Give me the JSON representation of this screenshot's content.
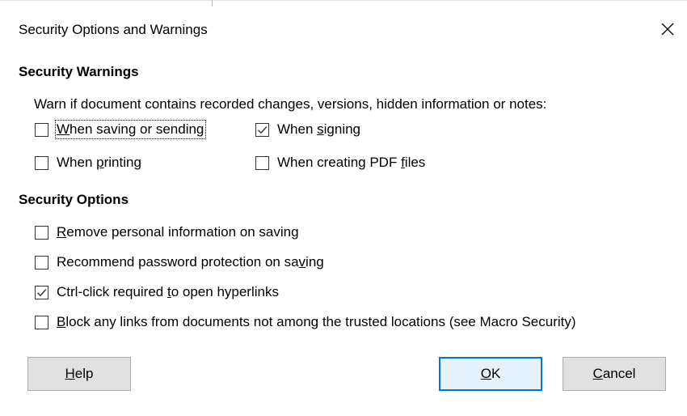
{
  "dialog": {
    "title": "Security Options and Warnings",
    "close_icon": "close-icon"
  },
  "security_warnings": {
    "heading": "Security Warnings",
    "description": "Warn if document contains recorded changes, versions, hidden information or notes:",
    "options": [
      {
        "pre": "",
        "key": "W",
        "post": "hen saving or sending",
        "checked": false,
        "focused": true
      },
      {
        "pre": "When ",
        "key": "s",
        "post": "igning",
        "checked": true,
        "focused": false
      },
      {
        "pre": "When ",
        "key": "p",
        "post": "rinting",
        "checked": false,
        "focused": false
      },
      {
        "pre": "When creating PDF ",
        "key": "f",
        "post": "iles",
        "checked": false,
        "focused": false
      }
    ]
  },
  "security_options": {
    "heading": "Security Options",
    "options": [
      {
        "pre": "",
        "key": "R",
        "post": "emove personal information on saving",
        "checked": false
      },
      {
        "pre": "Recommend password protection on sa",
        "key": "v",
        "post": "ing",
        "checked": false
      },
      {
        "pre": "Ctrl-click required ",
        "key": "t",
        "post": "o open hyperlinks",
        "checked": true
      },
      {
        "pre": "",
        "key": "B",
        "post": "lock any links from documents not among the trusted locations (see Macro Security)",
        "checked": false
      }
    ]
  },
  "buttons": {
    "help": {
      "key": "H",
      "post": "elp"
    },
    "ok": {
      "key": "O",
      "post": "K"
    },
    "cancel": {
      "key": "C",
      "post": "ancel"
    }
  },
  "colors": {
    "default_button_border": "#0078d7",
    "button_face": "#e1e1e1",
    "checkmark": "#333333"
  }
}
